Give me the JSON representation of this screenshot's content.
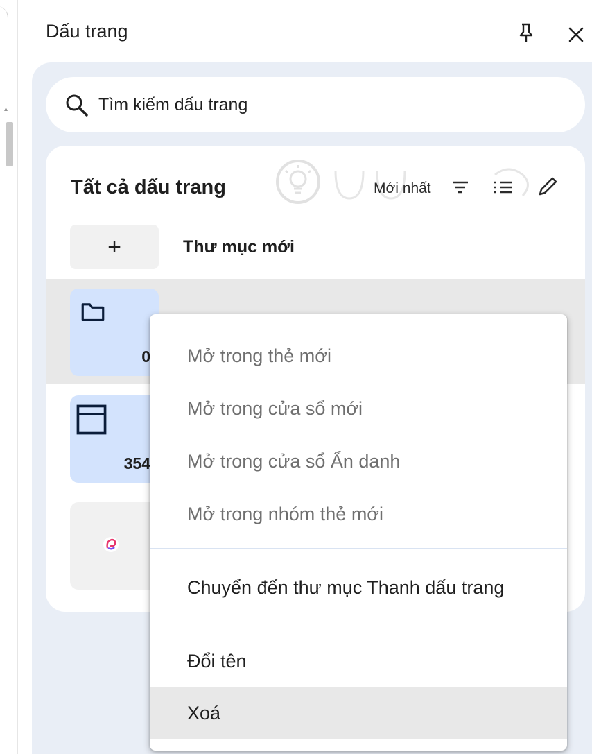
{
  "panel": {
    "title": "Dấu trang"
  },
  "search": {
    "placeholder": "Tìm kiếm dấu trang"
  },
  "card": {
    "title": "Tất cả dấu trang",
    "sort_label": "Mới nhất",
    "new_folder_label": "Thư mục mới",
    "tiles": [
      {
        "count": "0"
      },
      {
        "count": "354"
      },
      {
        "count": ""
      }
    ]
  },
  "context_menu": {
    "items": [
      {
        "label": "Mở trong thẻ mới",
        "state": "disabled"
      },
      {
        "label": "Mở trong cửa sổ mới",
        "state": "disabled"
      },
      {
        "label": "Mở trong cửa sổ Ẩn danh",
        "state": "disabled"
      },
      {
        "label": "Mở trong nhóm thẻ mới",
        "state": "disabled"
      },
      {
        "label": "Chuyển đến thư mục Thanh dấu trang",
        "state": "enabled"
      },
      {
        "label": "Đổi tên",
        "state": "enabled"
      },
      {
        "label": "Xoá",
        "state": "hovered"
      }
    ]
  },
  "colors": {
    "panel_background": "#e9eef6",
    "tile_blue": "#d3e3fd",
    "icon_navy": "#0b1d3a",
    "hover_gray": "#e8e8e8"
  },
  "icons": [
    "pin-icon",
    "close-icon",
    "search-icon",
    "sort-icon",
    "list-view-icon",
    "edit-icon",
    "folder-icon",
    "window-icon",
    "favicon-icon",
    "plus-icon"
  ]
}
